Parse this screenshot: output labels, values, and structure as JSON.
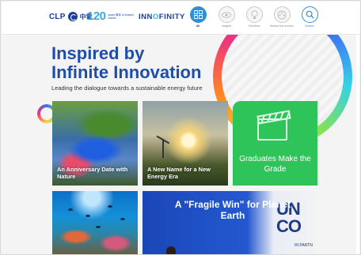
{
  "header": {
    "logo_text": "CLP",
    "logo_chinese": "中電",
    "years_number": "120",
    "years_caption": "years 周年 of shared values",
    "campaign_name_start": "INN",
    "campaign_name_o": "O",
    "campaign_name_end": "FINITY",
    "nav": [
      {
        "label": "All",
        "icon": "grid-icon",
        "active": true
      },
      {
        "label": "Insights",
        "icon": "eye-icon",
        "active": false
      },
      {
        "label": "Solutions",
        "icon": "lightbulb-icon",
        "active": false
      },
      {
        "label": "Behind the scenes",
        "icon": "film-icon",
        "active": false
      },
      {
        "label": "Search",
        "icon": "search-icon",
        "active": false
      }
    ]
  },
  "hero": {
    "title_line1": "Inspired by",
    "title_line2": "Infinite Innovation",
    "subtitle": "Leading the dialogue towards a sustainable energy future"
  },
  "cards": [
    {
      "title": "An Anniversary Date with Nature"
    },
    {
      "title": "A New Name for a New Energy Era"
    },
    {
      "title": "Graduates Make the Grade",
      "icon": "clapperboard-icon"
    },
    {
      "title": ""
    },
    {
      "title": "A \"Fragile Win\" for Planet Earth",
      "background_text": "UN CO",
      "background_subtext": "IN PARTN"
    }
  ],
  "colors": {
    "brand_blue": "#1f4da8",
    "accent_blue": "#2f8fd8",
    "green_card": "#2ec45a"
  }
}
